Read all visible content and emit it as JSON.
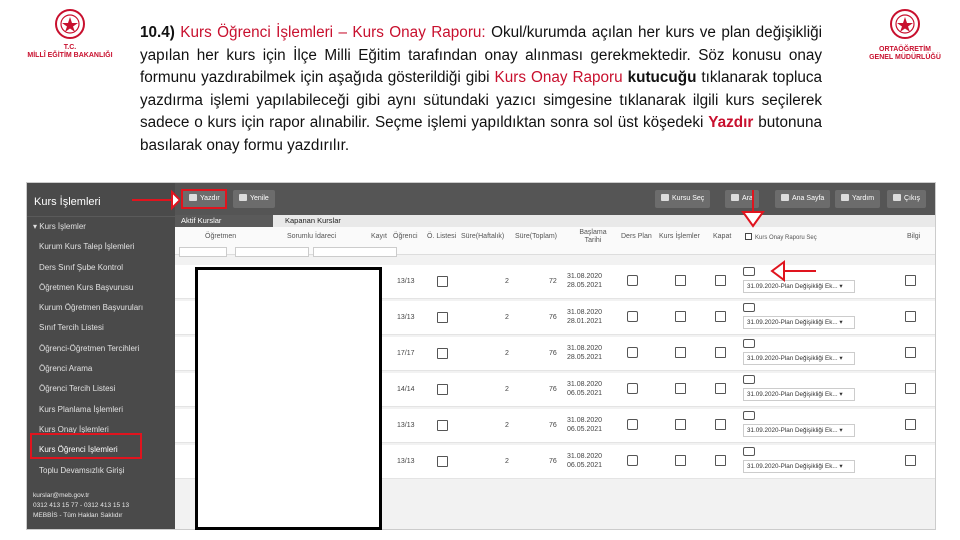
{
  "logos": {
    "left_lines": [
      "T.C.",
      "MİLLÎ EĞİTİM BAKANLIĞI"
    ],
    "right_lines": [
      "ORTAÖĞRETİM",
      "GENEL MÜDÜRLÜĞÜ"
    ]
  },
  "description": {
    "number": "10.4)",
    "title": "Kurs Öğrenci İşlemleri – Kurs Onay Raporu:",
    "p1": " Okul/kurumda açılan her kurs ve plan değişikliği yapılan her kurs için İlçe Milli Eğitim tarafından onay alınması gerekmektedir. Söz konusu onay formunu yazdırabilmek için aşağıda gösterildiği gibi ",
    "kor": "Kurs Onay Raporu",
    "kutucugu": " kutucuğu",
    "p2": " tıklanarak topluca yazdırma işlemi yapılabileceği gibi aynı sütundaki yazıcı simgesine tıklanarak ilgili kurs seçilerek sadece o kurs için rapor alınabilir. Seçme işlemi yapıldıktan sonra sol üst köşedeki ",
    "yazdir": "Yazdır",
    "p3": " butonuna basılarak onay formu yazdırılır."
  },
  "sidebar": {
    "title": "Kurs İşlemleri",
    "items": [
      "Kurs İşlemler",
      "Kurum Kurs Talep İşlemleri",
      "Ders Sınıf Şube Kontrol",
      "Öğretmen Kurs Başvurusu",
      "Kurum Öğretmen Başvuruları",
      "Sınıf Tercih Listesi",
      "Öğrenci-Öğretmen Tercihleri",
      "Öğrenci Arama",
      "Öğrenci Tercih Listesi",
      "Kurs Planlama İşlemleri",
      "Kurs Onay İşlemleri",
      "Kurs Öğrenci İşlemleri",
      "Toplu Devamsızlık Girişi"
    ],
    "footer": [
      "kurslar@meb.gov.tr",
      "0312 413 15 77 - 0312 413 15 13",
      "MEBBİS - Tüm Hakları Saklıdır"
    ]
  },
  "toolbar": {
    "print": "Yazdır",
    "refresh": "Yenile",
    "course_select": "Kursu Seç",
    "search": "Ara",
    "homepage": "Ana Sayfa",
    "help": "Yardım",
    "logout": "Çıkış"
  },
  "tabs": {
    "active": "Aktif Kurslar",
    "closed": "Kapanan Kurslar"
  },
  "columns": [
    "Öğretmen",
    "Sorumlu İdareci",
    "Kayıt",
    "Öğrenci",
    "Ö. Listesi",
    "Süre(Haftalık)",
    "Süre(Toplam)",
    "Başlama Tarihi",
    "Ders Plan",
    "Kurs İşlemler",
    "Kapat",
    "Kurs Onay Raporu Seç",
    "Bilgi"
  ],
  "rows": [
    {
      "kayit": "13/13",
      "sh": "2",
      "st": "72",
      "start": "31.08.2020",
      "end": "28.05.2021",
      "plan": "31.09.2020-Plan Değişikliği Ek..."
    },
    {
      "kayit": "13/13",
      "sh": "2",
      "st": "76",
      "start": "31.08.2020",
      "end": "28.01.2021",
      "plan": "31.09.2020-Plan Değişikliği Ek..."
    },
    {
      "kayit": "17/17",
      "sh": "2",
      "st": "76",
      "start": "31.08.2020",
      "end": "28.05.2021",
      "plan": "31.09.2020-Plan Değişikliği Ek..."
    },
    {
      "kayit": "14/14",
      "sh": "2",
      "st": "76",
      "start": "31.08.2020",
      "end": "06.05.2021",
      "plan": "31.09.2020-Plan Değişikliği Ek..."
    },
    {
      "kayit": "13/13",
      "sh": "2",
      "st": "76",
      "start": "31.08.2020",
      "end": "06.05.2021",
      "plan": "31.09.2020-Plan Değişikliği Ek..."
    },
    {
      "kayit": "13/13",
      "sh": "2",
      "st": "76",
      "start": "31.08.2020",
      "end": "06.05.2021",
      "plan": "31.09.2020-Plan Değişikliği Ek..."
    }
  ],
  "colors": {
    "brand_red": "#c8102e",
    "sidebar": "#4a4a4a",
    "annotation_red": "#e0141e"
  }
}
